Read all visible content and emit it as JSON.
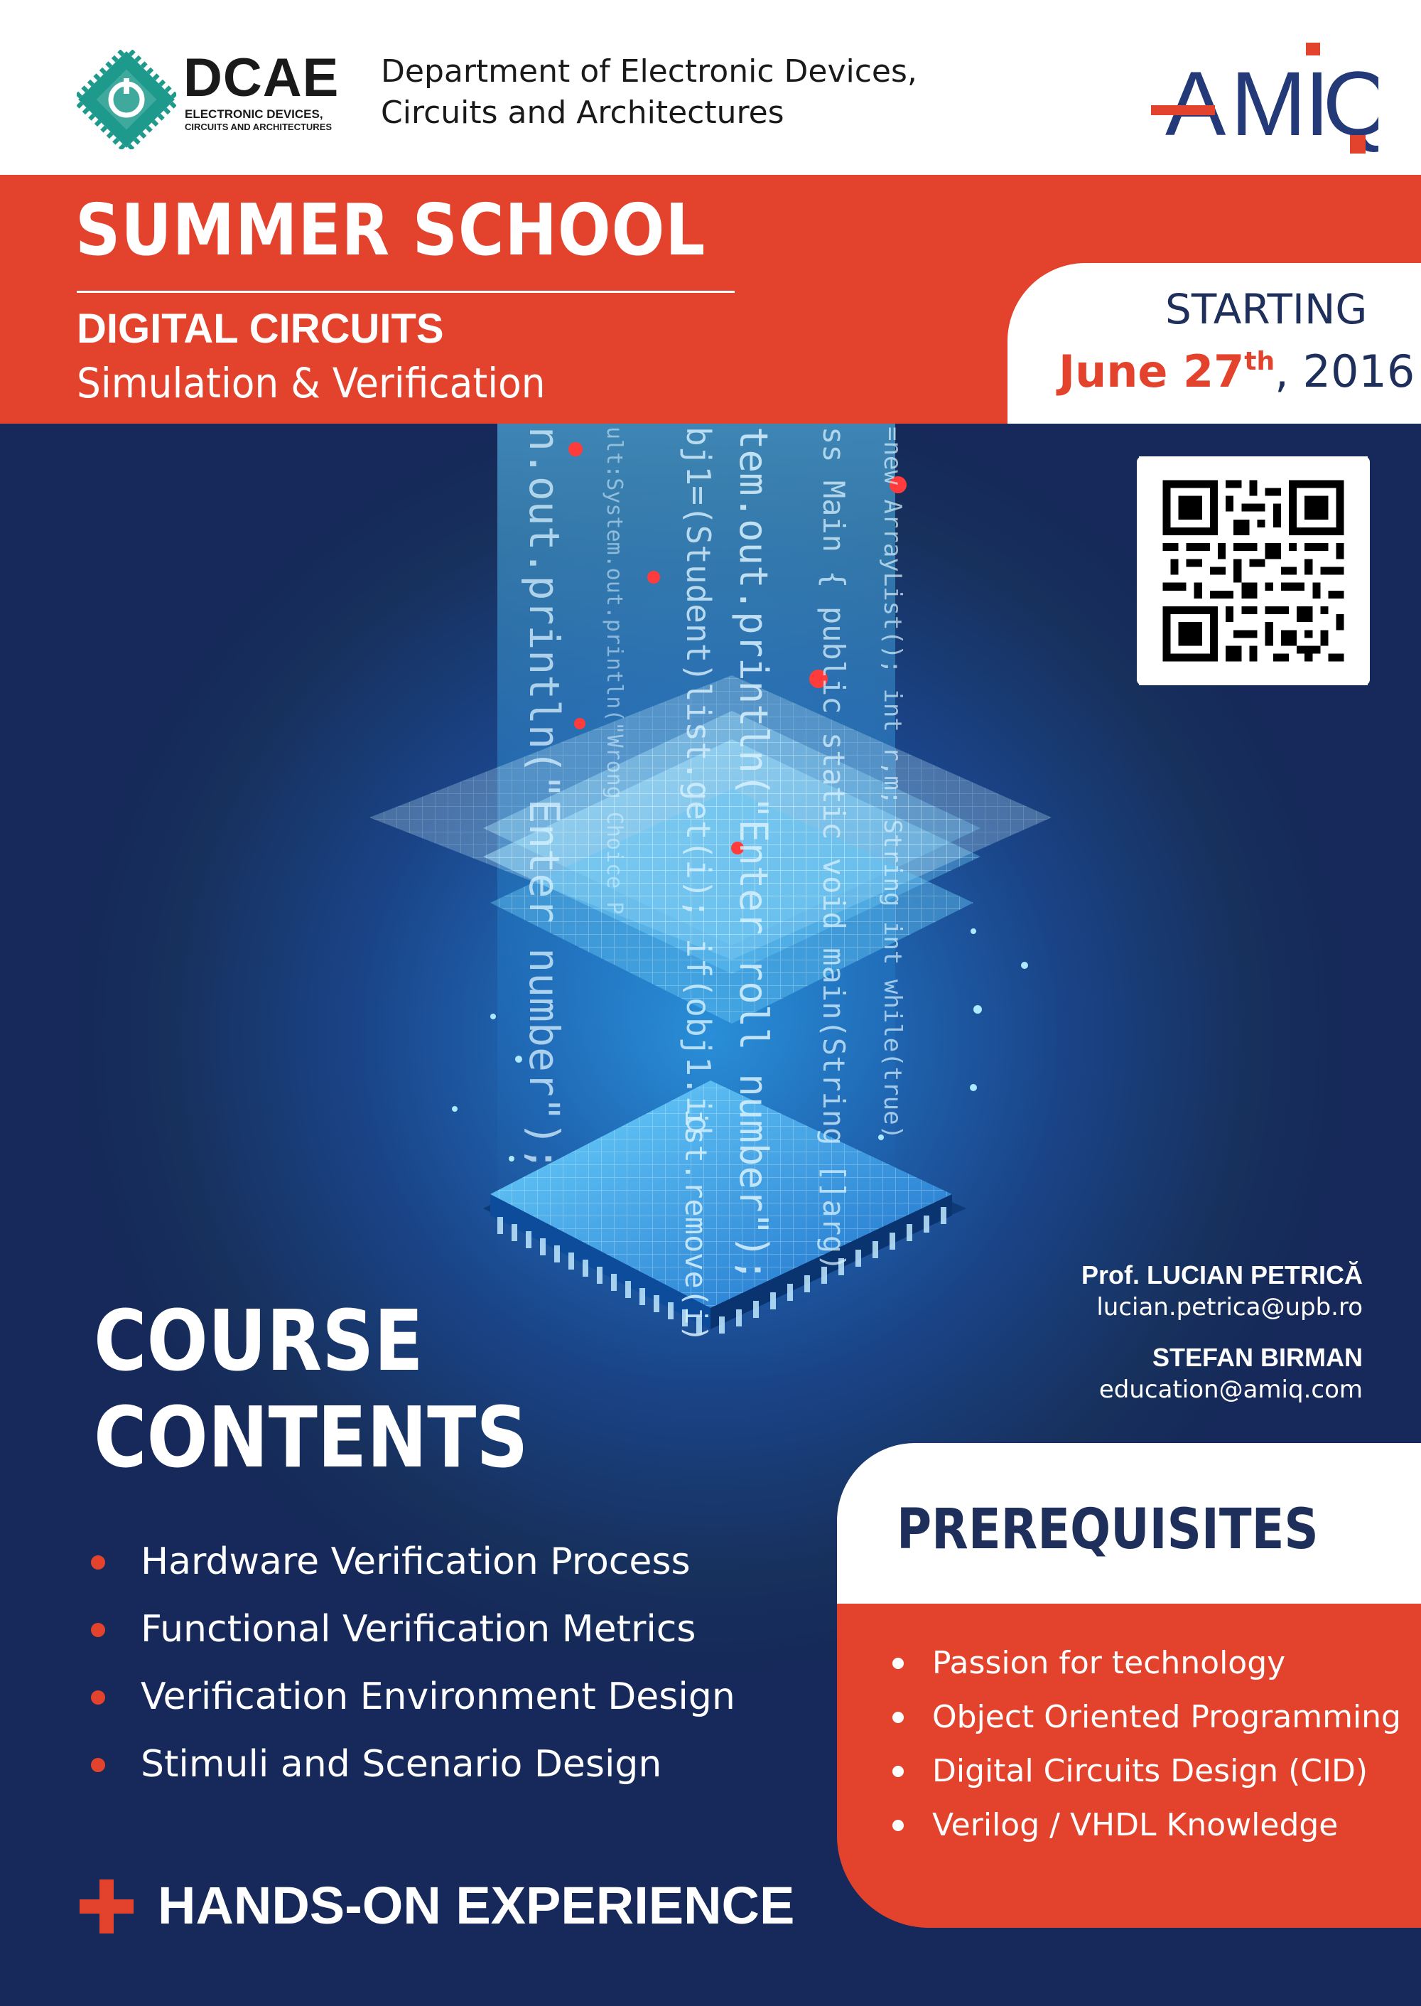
{
  "header": {
    "dcae_brand": "DCAE",
    "dcae_subtitle_line1": "ELECTRONIC DEVICES,",
    "dcae_subtitle_line2": "CIRCUITS AND ARCHITECTURES",
    "department_line1": "Department of Electronic Devices,",
    "department_line2": "Circuits and Architectures",
    "amiq_logo_text": "AMIQ"
  },
  "title": {
    "main": "SUMMER SCHOOL",
    "sub1": "DIGITAL CIRCUITS",
    "sub2": "Simulation & Verification"
  },
  "starting": {
    "label": "STARTING",
    "month_day": "June 27",
    "ordinal": "th",
    "year": ", 2016"
  },
  "qr_code": {
    "icon": "qr-code-icon"
  },
  "code_decoration": {
    "col1": "n.out.println(\"Enter number\");",
    "col2": "ult:System.out.println(\"Wrong Choice P",
    "col3": "bj1=(Student)list.get(i); if(obj1.id",
    "col4": "tem.out.println(\"Enter roll number\");",
    "col5": "ss Main { public static void main(String []arg)",
    "col6": "=new ArrayList(); int r,m; String   int  while(true)",
    "col7": "ist.remove(i)"
  },
  "colors": {
    "accent_red": "#e3432d",
    "navy": "#1d2f5a",
    "deep_blue": "#17305c",
    "dcae_teal": "#1e9a8c"
  },
  "contacts": {
    "person1_name": "Prof. LUCIAN PETRICĂ",
    "person1_email": "lucian.petrica@upb.ro",
    "person2_name": "STEFAN BIRMAN",
    "person2_email": "education@amiq.com"
  },
  "course_contents": {
    "title_line1": "COURSE",
    "title_line2": "CONTENTS",
    "items": [
      "Hardware Verification Process",
      "Functional Verification Metrics",
      "Verification Environment Design",
      "Stimuli and Scenario Design"
    ],
    "hands_on": "HANDS-ON EXPERIENCE"
  },
  "prerequisites": {
    "title": "PREREQUISITES",
    "items": [
      "Passion for technology",
      "Object Oriented Programming",
      "Digital Circuits Design (CID)",
      "Verilog / VHDL Knowledge"
    ]
  }
}
